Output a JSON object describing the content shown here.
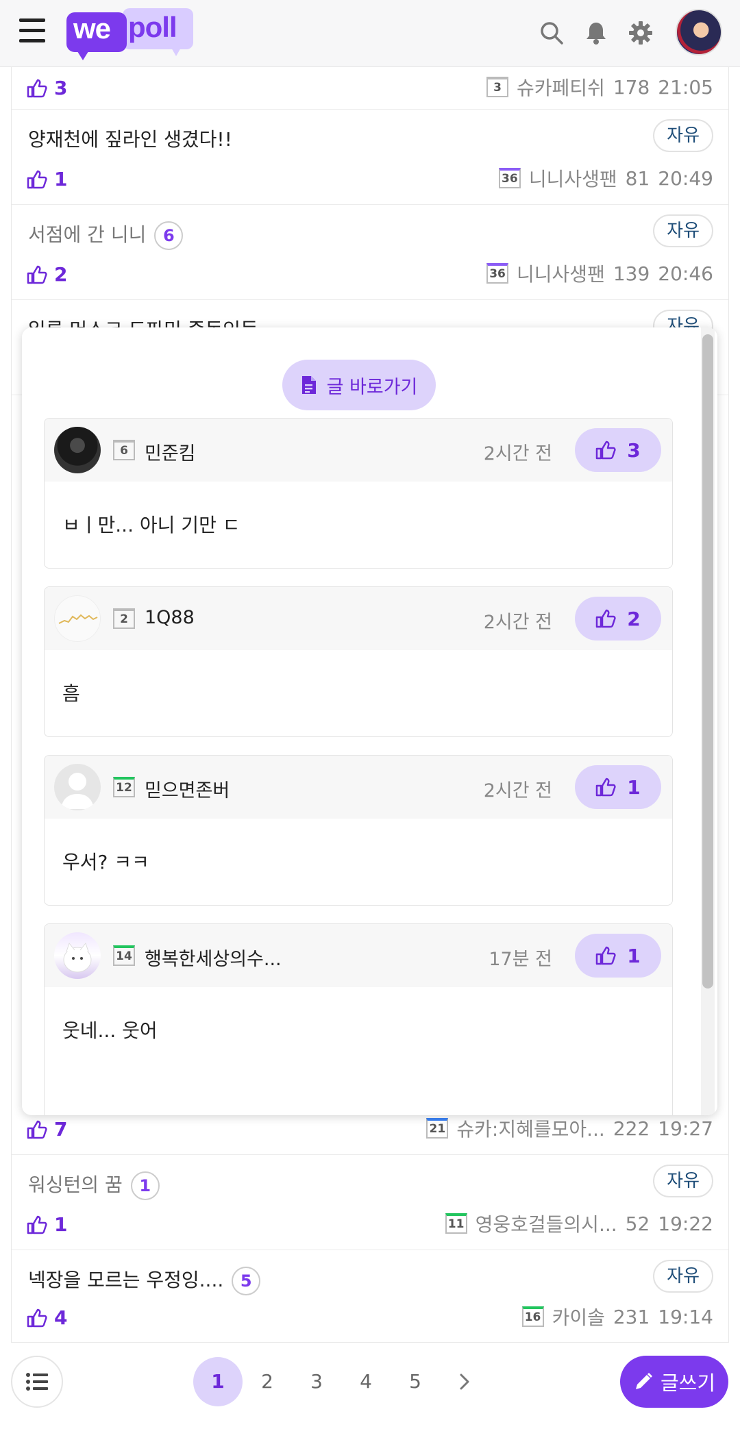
{
  "header": {
    "logo_we": "we",
    "logo_poll": "poll"
  },
  "posts": [
    {
      "title": "",
      "comments": "",
      "tag": "",
      "likes": "3",
      "level": "3",
      "level_color": "gray",
      "author": "슈카페티쉬",
      "views": "178",
      "time": "21:05"
    },
    {
      "title": "양재천에 짚라인 생겼다!!",
      "comments": "",
      "tag": "자유",
      "likes": "1",
      "level": "36",
      "level_color": "purple",
      "author": "니니사생팬",
      "views": "81",
      "time": "20:49"
    },
    {
      "title": "서점에 간 니니",
      "comments": "6",
      "tag": "자유",
      "likes": "2",
      "level": "36",
      "level_color": "purple",
      "author": "니니사생팬",
      "views": "139",
      "time": "20:46"
    },
    {
      "title": "일론 머스크 도파민 중독인듯",
      "comments": "",
      "tag": "자유",
      "likes": "",
      "level": "",
      "author": "",
      "views": "",
      "time": ""
    },
    {
      "title": "",
      "comments": "",
      "tag": "",
      "likes": "7",
      "level": "21",
      "level_color": "blue",
      "author": "슈카:지혜를모아...",
      "views": "222",
      "time": "19:27"
    },
    {
      "title": "워싱턴의 꿈",
      "comments": "1",
      "tag": "자유",
      "likes": "1",
      "level": "11",
      "level_color": "green",
      "author": "영웅호걸들의시...",
      "views": "52",
      "time": "19:22"
    },
    {
      "title": "넥장을 모르는 우정잉....",
      "comments": "5",
      "tag": "자유",
      "likes": "4",
      "level": "16",
      "level_color": "green",
      "author": "카이솔",
      "views": "231",
      "time": "19:14"
    }
  ],
  "popup": {
    "goto_label": "글 바로가기",
    "comments": [
      {
        "level": "6",
        "level_color": "gray",
        "name": "민준킴",
        "time": "2시간 전",
        "likes": "3",
        "body": "ㅂㅣ만... 아니 기만 ㄷ",
        "avatar": "dark-photo"
      },
      {
        "level": "2",
        "level_color": "gray",
        "name": "1Q88",
        "time": "2시간 전",
        "likes": "2",
        "body": "흠",
        "avatar": "chart-photo"
      },
      {
        "level": "12",
        "level_color": "green",
        "name": "믿으면존버",
        "time": "2시간 전",
        "likes": "1",
        "body": "우서? ㅋㅋ",
        "avatar": "default-avatar"
      },
      {
        "level": "14",
        "level_color": "green",
        "name": "행복한세상의수...",
        "time": "17분 전",
        "likes": "1",
        "body": "웃네... 웃어",
        "avatar": "cat-photo"
      }
    ]
  },
  "pagination": {
    "pages": [
      "1",
      "2",
      "3",
      "4",
      "5"
    ],
    "active": "1"
  },
  "write_label": "글쓰기",
  "colors": {
    "accent": "#7c3aed",
    "accent_light": "#ddd3fb",
    "tag_text": "#1f4e79"
  }
}
